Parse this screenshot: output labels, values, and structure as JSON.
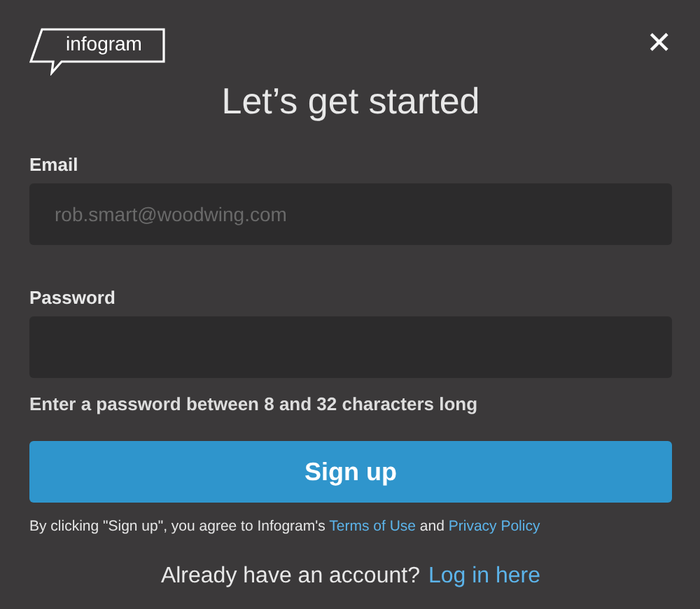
{
  "logo": {
    "text": "infogram"
  },
  "close": {
    "glyph": "✕"
  },
  "title": "Let’s get started",
  "fields": [
    {
      "label": "Email",
      "placeholder": "rob.smart@woodwing.com"
    },
    {
      "label": "Password",
      "hint": "Enter a password between 8 and 32 characters long"
    }
  ],
  "submit": "Sign up",
  "consent": [
    {
      "kind": "text",
      "text": "By clicking \"Sign up\", you agree to Infogram's "
    },
    {
      "kind": "link",
      "text": "Terms of Use"
    },
    {
      "kind": "text",
      "text": " and "
    },
    {
      "kind": "link",
      "text": "Privacy Policy"
    }
  ],
  "login": {
    "question": "Already have an account?",
    "link": "Log in here"
  }
}
